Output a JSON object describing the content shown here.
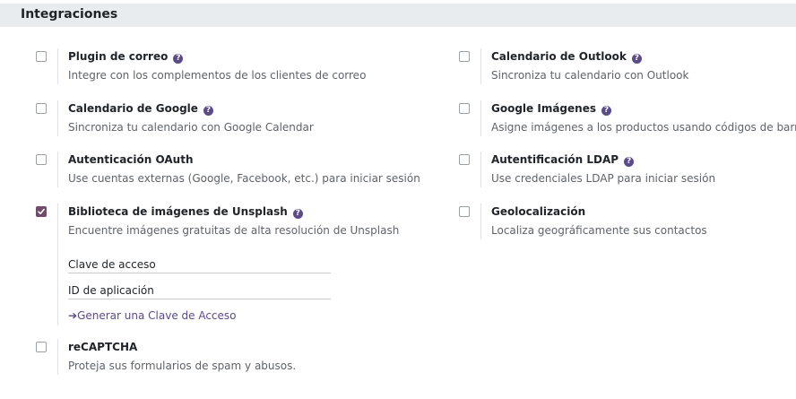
{
  "section": {
    "title": "Integraciones"
  },
  "settings": {
    "mail_plugin": {
      "title": "Plugin de correo",
      "description": "Integre con los complementos de los clientes de correo",
      "checked": false
    },
    "outlook_calendar": {
      "title": "Calendario de Outlook",
      "description": "Sincroniza tu calendario con Outlook",
      "checked": false
    },
    "google_calendar": {
      "title": "Calendario de Google",
      "description": "Sincroniza tu calendario con Google Calendar",
      "checked": false
    },
    "google_images": {
      "title": "Google Imágenes",
      "description": "Asigne imágenes a los productos usando códigos de barras",
      "checked": false
    },
    "oauth": {
      "title": "Autenticación OAuth",
      "description": "Use cuentas externas (Google, Facebook, etc.) para iniciar sesión",
      "checked": false
    },
    "ldap": {
      "title": "Autentificación LDAP",
      "description": "Use credenciales LDAP para iniciar sesión",
      "checked": false
    },
    "unsplash": {
      "title": "Biblioteca de imágenes de Unsplash",
      "description": "Encuentre imágenes gratuitas de alta resolución de Unsplash",
      "checked": true,
      "access_key_label": "Clave de acceso",
      "app_id_label": "ID de aplicación",
      "generate_link": "Generar una Clave de Acceso"
    },
    "geolocation": {
      "title": "Geolocalización",
      "description": "Localiza geográficamente sus contactos",
      "checked": false
    },
    "recaptcha": {
      "title": "reCAPTCHA",
      "description": "Proteja sus formularios de spam y abusos.",
      "checked": false
    }
  },
  "icons": {
    "help": "question-circle-icon",
    "checkmark": "checkmark-icon",
    "link_arrow": "arrow-right-icon"
  },
  "colors": {
    "accent": "#714b67",
    "help_icon": "#5b4b8a",
    "header_bg": "#e9ecef"
  }
}
